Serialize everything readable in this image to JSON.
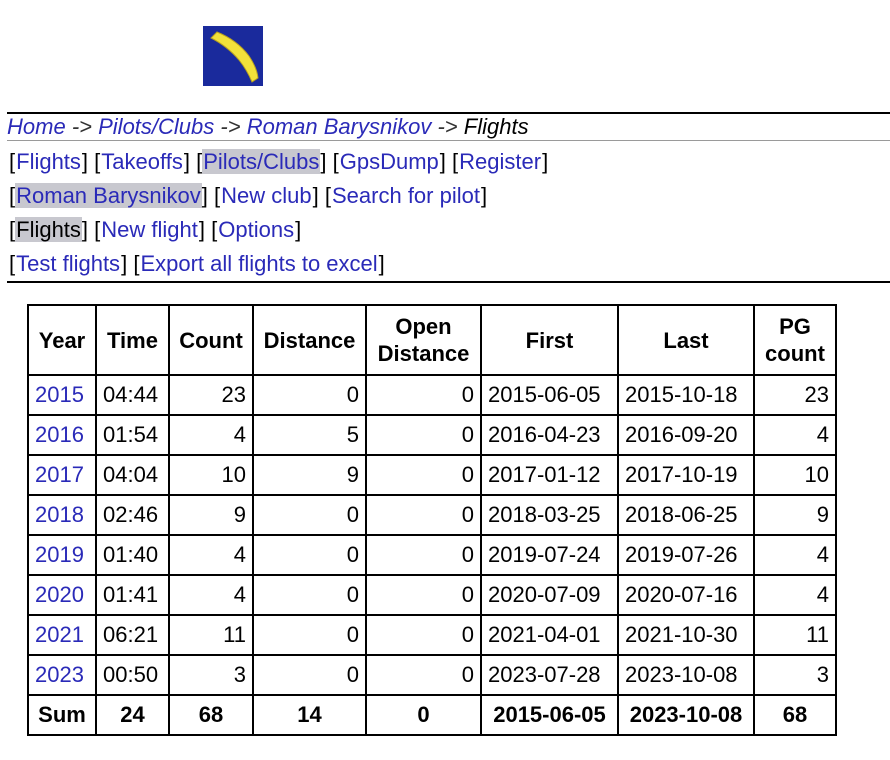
{
  "breadcrumb": {
    "items": [
      "Home",
      "Pilots/Clubs",
      "Roman Barysnikov"
    ],
    "separator": "->",
    "current": "Flights"
  },
  "nav": {
    "row1": [
      "Flights",
      "Takeoffs",
      "Pilots/Clubs",
      "GpsDump",
      "Register"
    ],
    "row2": [
      "Roman Barysnikov",
      "New club",
      "Search for pilot"
    ],
    "row3": [
      "Flights",
      "New flight",
      "Options"
    ],
    "row4": [
      "Test flights",
      "Export all flights to excel"
    ]
  },
  "table": {
    "headers": {
      "year": "Year",
      "time": "Time",
      "count": "Count",
      "distance": "Distance",
      "open_1": "Open",
      "open_2": "Distance",
      "first": "First",
      "last": "Last",
      "pg_1": "PG",
      "pg_2": "count"
    },
    "rows": [
      {
        "year": "2015",
        "time": "04:44",
        "count": "23",
        "distance": "0",
        "open": "0",
        "first": "2015-06-05",
        "last": "2015-10-18",
        "pg": "23"
      },
      {
        "year": "2016",
        "time": "01:54",
        "count": "4",
        "distance": "5",
        "open": "0",
        "first": "2016-04-23",
        "last": "2016-09-20",
        "pg": "4"
      },
      {
        "year": "2017",
        "time": "04:04",
        "count": "10",
        "distance": "9",
        "open": "0",
        "first": "2017-01-12",
        "last": "2017-10-19",
        "pg": "10"
      },
      {
        "year": "2018",
        "time": "02:46",
        "count": "9",
        "distance": "0",
        "open": "0",
        "first": "2018-03-25",
        "last": "2018-06-25",
        "pg": "9"
      },
      {
        "year": "2019",
        "time": "01:40",
        "count": "4",
        "distance": "0",
        "open": "0",
        "first": "2019-07-24",
        "last": "2019-07-26",
        "pg": "4"
      },
      {
        "year": "2020",
        "time": "01:41",
        "count": "4",
        "distance": "0",
        "open": "0",
        "first": "2020-07-09",
        "last": "2020-07-16",
        "pg": "4"
      },
      {
        "year": "2021",
        "time": "06:21",
        "count": "11",
        "distance": "0",
        "open": "0",
        "first": "2021-04-01",
        "last": "2021-10-30",
        "pg": "11"
      },
      {
        "year": "2023",
        "time": "00:50",
        "count": "3",
        "distance": "0",
        "open": "0",
        "first": "2023-07-28",
        "last": "2023-10-08",
        "pg": "3"
      }
    ],
    "sum": {
      "label": "Sum",
      "time": "24",
      "count": "68",
      "distance": "14",
      "open": "0",
      "first": "2015-06-05",
      "last": "2023-10-08",
      "pg": "68"
    }
  },
  "icons": {
    "logo": "boomerang-logo-icon"
  },
  "colors": {
    "link": "#2a2ab8",
    "logo_background": "#1a2a9c",
    "logo_boomerang": "#f2e13a",
    "active_nav_background": "#c8c8cf"
  }
}
